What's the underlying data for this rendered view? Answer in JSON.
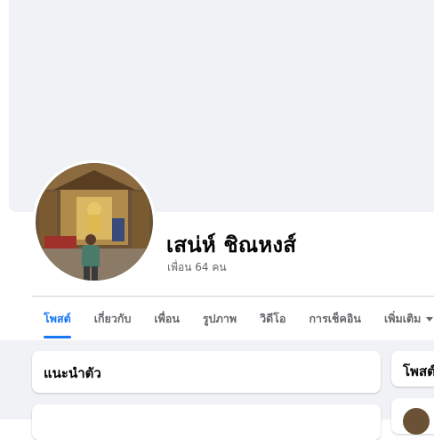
{
  "profile": {
    "name": "เสน่ห์ ชิณหงส์",
    "friends_count": "เพื่อน 64 คน"
  },
  "tabs": [
    {
      "label": "โพสต์",
      "active": true
    },
    {
      "label": "เกี่ยวกับ",
      "active": false
    },
    {
      "label": "เพื่อน",
      "active": false
    },
    {
      "label": "รูปภาพ",
      "active": false
    },
    {
      "label": "วิดีโอ",
      "active": false
    },
    {
      "label": "การเช็คอิน",
      "active": false
    },
    {
      "label": "เพิ่มเติม",
      "active": false
    }
  ],
  "intro_card": {
    "title": "แนะนำตัว"
  },
  "posts_card": {
    "title": "โพสต์"
  },
  "colors": {
    "accent": "#1877f2",
    "page_background": "#f0f2f5",
    "secondary_text": "#65676b"
  }
}
